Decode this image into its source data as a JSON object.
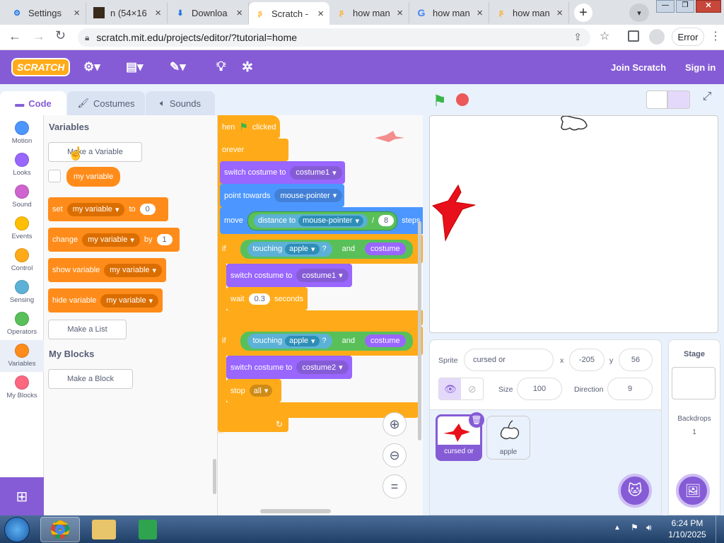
{
  "browser": {
    "tabs": [
      {
        "title": "Settings",
        "icon": "gear-icon"
      },
      {
        "title": "n (54×16",
        "icon": "image-icon"
      },
      {
        "title": "Downloa",
        "icon": "download-icon"
      },
      {
        "title": "Scratch -",
        "icon": "scratch-icon"
      },
      {
        "title": "how man",
        "icon": "scratch-icon"
      },
      {
        "title": "how man",
        "icon": "google-icon"
      },
      {
        "title": "how man",
        "icon": "scratch-icon"
      }
    ],
    "url": "scratch.mit.edu/projects/editor/?tutorial=home",
    "profile_label": "Error"
  },
  "scratch_menu": {
    "logo": "SCRATCH",
    "join": "Join Scratch",
    "signin": "Sign in"
  },
  "editor_tabs": {
    "code": "Code",
    "costumes": "Costumes",
    "sounds": "Sounds"
  },
  "categories": [
    {
      "label": "Motion",
      "color": "#4c97ff"
    },
    {
      "label": "Looks",
      "color": "#9966ff"
    },
    {
      "label": "Sound",
      "color": "#cf63cf"
    },
    {
      "label": "Events",
      "color": "#ffbf00"
    },
    {
      "label": "Control",
      "color": "#ffab19"
    },
    {
      "label": "Sensing",
      "color": "#5cb1d6"
    },
    {
      "label": "Operators",
      "color": "#59c059"
    },
    {
      "label": "Variables",
      "color": "#ff8c1a"
    },
    {
      "label": "My Blocks",
      "color": "#ff6680"
    }
  ],
  "palette": {
    "heading_variables": "Variables",
    "make_variable": "Make a Variable",
    "my_variable": "my variable",
    "set_block": {
      "verb": "set",
      "var": "my variable",
      "to": "to",
      "value": "0"
    },
    "change_block": {
      "verb": "change",
      "var": "my variable",
      "by": "by",
      "value": "1"
    },
    "show_block": {
      "verb": "show variable",
      "var": "my variable"
    },
    "hide_block": {
      "verb": "hide variable",
      "var": "my variable"
    },
    "make_list": "Make a List",
    "heading_myblocks": "My Blocks",
    "make_block": "Make a Block"
  },
  "script": {
    "hat": {
      "when": "hen",
      "clicked": "clicked"
    },
    "forever": "orever",
    "switch1": {
      "label": "switch costume to",
      "value": "costume1"
    },
    "point": {
      "label": "point towards",
      "value": "mouse-pointer"
    },
    "move": {
      "label": "move",
      "op": "distance to",
      "target": "mouse-pointer",
      "div": "/",
      "value": "8",
      "steps": "steps"
    },
    "if1": {
      "if": "if",
      "touching": "touching",
      "obj": "apple",
      "q": "?",
      "and": "and",
      "costume": "costume"
    },
    "switch2": {
      "label": "switch costume to",
      "value": "costume1"
    },
    "wait": {
      "label": "wait",
      "value": "0.3",
      "seconds": "seconds"
    },
    "if2": {
      "if": "if",
      "touching": "touching",
      "obj": "apple",
      "q": "?",
      "and": "and",
      "costume": "costume"
    },
    "switch3": {
      "label": "switch costume to",
      "value": "costume2"
    },
    "stop": {
      "label": "stop",
      "value": "all"
    },
    "zoom_reset": "="
  },
  "sprite_info": {
    "sprite_label": "Sprite",
    "sprite_name": "cursed or",
    "x_label": "x",
    "x": "-205",
    "y_label": "y",
    "y": "56",
    "size_label": "Size",
    "size": "100",
    "direction_label": "Direction",
    "direction": "9"
  },
  "sprites": [
    {
      "name": "cursed or",
      "selected": true
    },
    {
      "name": "apple",
      "selected": false
    }
  ],
  "stage_pane": {
    "title": "Stage",
    "backdrops_label": "Backdrops",
    "backdrops_count": "1"
  },
  "taskbar": {
    "time": "6:24 PM",
    "date": "1/10/2025"
  },
  "colors": {
    "scratch_purple": "#855cd6",
    "variables_orange": "#ff8c1a"
  }
}
